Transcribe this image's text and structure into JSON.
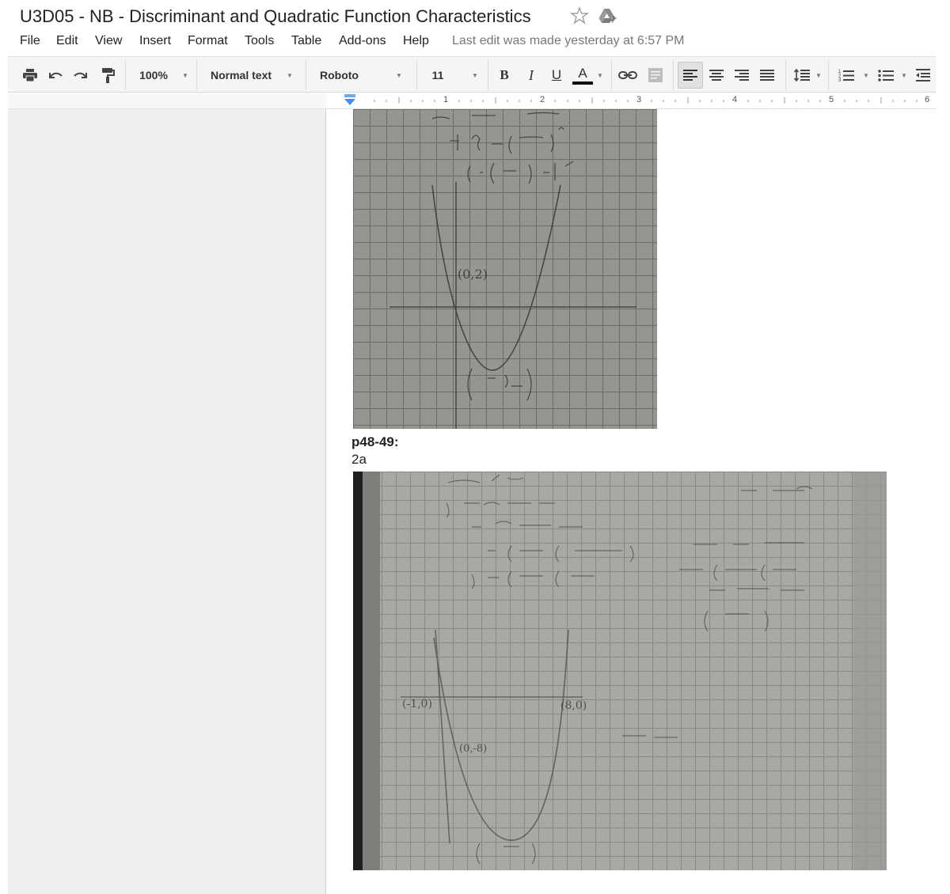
{
  "title": {
    "doc_name": "U3D05 - NB - Discriminant and Quadratic Function Characteristics",
    "star_icon": "star-icon",
    "drive_icon": "drive-icon"
  },
  "menu": {
    "items": [
      "File",
      "Edit",
      "View",
      "Insert",
      "Format",
      "Tools",
      "Table",
      "Add-ons",
      "Help"
    ],
    "last_edit": "Last edit was made yesterday at 6:57 PM"
  },
  "toolbar": {
    "zoom": "100%",
    "style": "Normal text",
    "font": "Roboto",
    "font_size": "11",
    "bold": "B",
    "italic": "I",
    "underline": "U",
    "text_color": "A"
  },
  "ruler": {
    "numbers": [
      "1",
      "2",
      "3",
      "4",
      "5",
      "6"
    ]
  },
  "document": {
    "section_heading": "p48-49:",
    "sub_label": "2a",
    "photo1_texts": [
      "(0,2)"
    ],
    "photo2_texts": [
      "(-1,0)",
      "(8,0)",
      "(0,-8)"
    ]
  }
}
